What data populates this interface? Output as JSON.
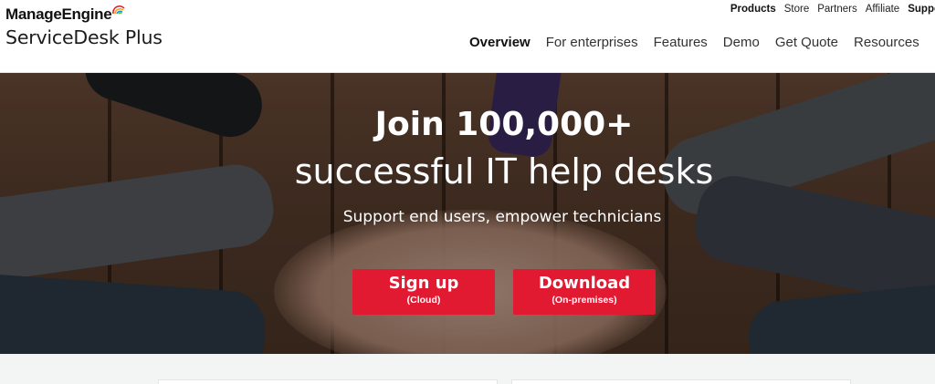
{
  "brand": {
    "company": "ManageEngine",
    "product": "ServiceDesk Plus",
    "accent_color": "#e11931"
  },
  "top_nav": [
    "Products",
    "Store",
    "Partners",
    "Affiliate",
    "Suppo"
  ],
  "main_nav": {
    "items": [
      "Overview",
      "For enterprises",
      "Features",
      "Demo",
      "Get Quote",
      "Resources"
    ],
    "active": "Overview"
  },
  "hero": {
    "title_line1": "Join 100,000+",
    "title_line2": "successful IT help desks",
    "subtitle": "Support end users, empower technicians",
    "signup": {
      "label": "Sign up",
      "sublabel": "(Cloud)"
    },
    "download": {
      "label": "Download",
      "sublabel": "(On-premises)"
    }
  }
}
